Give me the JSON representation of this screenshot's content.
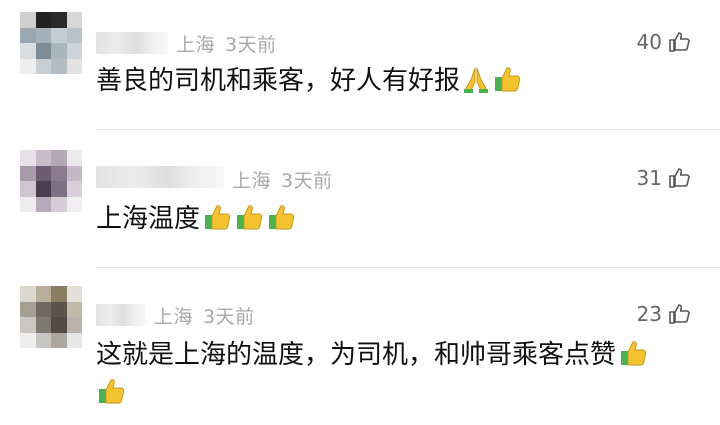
{
  "comments": [
    {
      "location": "上海",
      "time": "3天前",
      "likes": "40",
      "text": "善良的司机和乘客，好人有好报",
      "emojis": [
        "pray-emoji",
        "thumbs-up-emoji"
      ]
    },
    {
      "location": "上海",
      "time": "3天前",
      "likes": "31",
      "text": "上海温度",
      "emojis": [
        "thumbs-up-emoji",
        "thumbs-up-emoji",
        "thumbs-up-emoji"
      ]
    },
    {
      "location": "上海",
      "time": "3天前",
      "likes": "23",
      "text": "这就是上海的温度，为司机，和帅哥乘客点赞",
      "emojis": [
        "thumbs-up-emoji",
        "thumbs-up-emoji"
      ]
    }
  ],
  "icons": {
    "like": "thumbs-up-outline-icon"
  },
  "colors": {
    "meta": "#a8a8a8",
    "divider": "#e6e6e6",
    "emoji_yellow": "#f4c430",
    "emoji_green": "#4caf50"
  }
}
